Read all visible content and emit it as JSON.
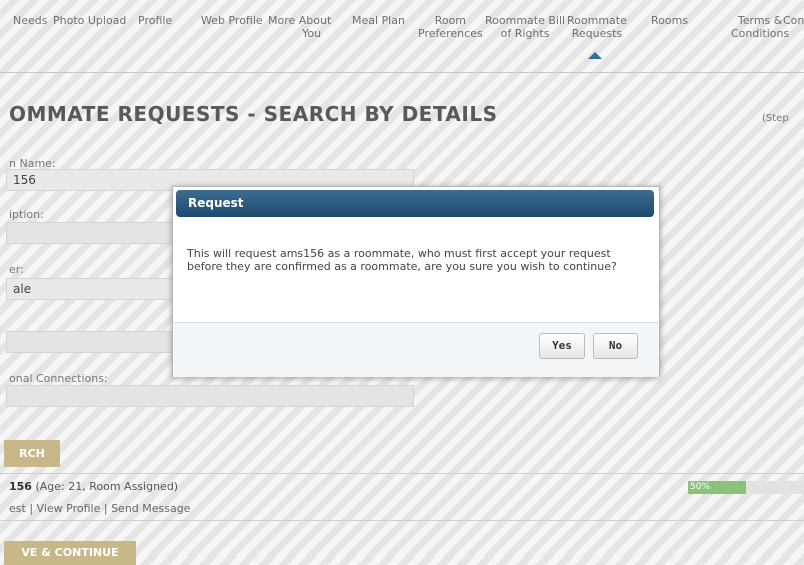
{
  "nav": {
    "items": [
      {
        "label": "Needs"
      },
      {
        "label": "Photo Upload"
      },
      {
        "label": "Profile"
      },
      {
        "label": "Web Profile"
      },
      {
        "line1": "More About",
        "line2": "You"
      },
      {
        "label": "Meal Plan"
      },
      {
        "line1": "Room",
        "line2": "Preferences"
      },
      {
        "line1": "Roommate Bill",
        "line2": "of Rights"
      },
      {
        "line1": "Roommate",
        "line2": "Requests"
      },
      {
        "label": "Rooms"
      },
      {
        "line1": "Terms &",
        "line2": "Conditions"
      },
      {
        "label": "Con"
      }
    ],
    "active": "Roommate Requests",
    "accent_color": "#2f6f98"
  },
  "page": {
    "title": "OMMATE REQUESTS - SEARCH BY DETAILS",
    "step": "(Step"
  },
  "form": {
    "login_label": "n Name:",
    "login_value": "156",
    "description_label": "iption:",
    "gender_label": "er:",
    "gender_value": "ale",
    "connections_label": "onal Connections:",
    "search_button": "RCH"
  },
  "result": {
    "name": "156",
    "details": "(Age: 21, Room Assigned)",
    "link_request": "est",
    "separator": "|",
    "link_view_profile": "View Profile",
    "link_send_message": "Send Message",
    "match_percent": 50,
    "match_text": "50%",
    "match_color": "#8bc17b"
  },
  "save_button": "VE & CONTINUE",
  "dialog": {
    "title": "Request",
    "message": "This will request ams156 as a roommate, who must first accept your request before they are confirmed as a roommate, are you sure you wish to continue?",
    "yes_label": "Yes",
    "no_label": "No",
    "header_color": "#1d4a6e"
  }
}
